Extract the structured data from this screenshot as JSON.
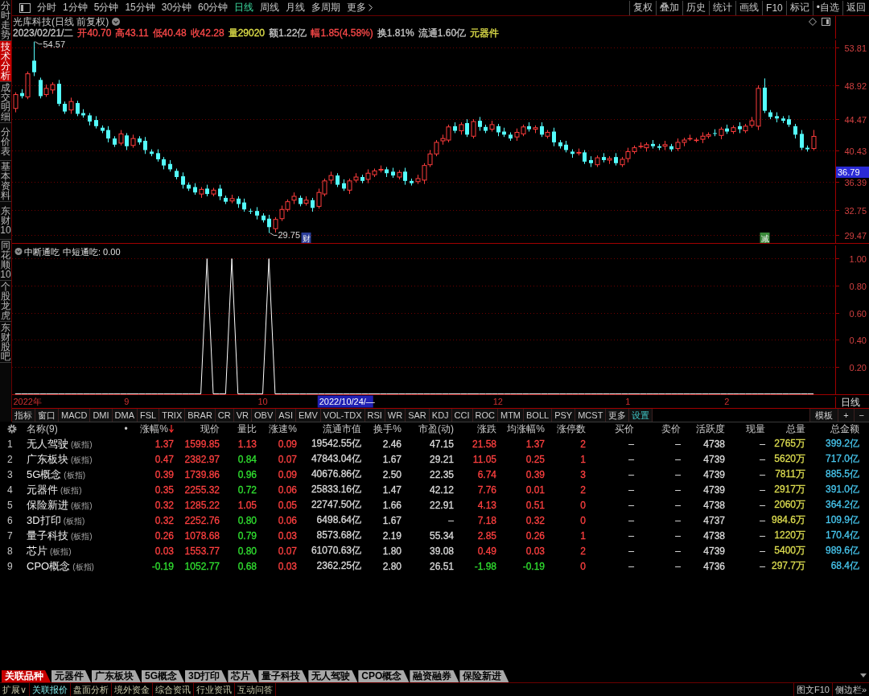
{
  "toolbar": {
    "periods": [
      {
        "label": "分时",
        "selected": false
      },
      {
        "label": "1分钟",
        "selected": false
      },
      {
        "label": "5分钟",
        "selected": false
      },
      {
        "label": "15分钟",
        "selected": false
      },
      {
        "label": "30分钟",
        "selected": false
      },
      {
        "label": "60分钟",
        "selected": false
      },
      {
        "label": "日线",
        "selected": true
      },
      {
        "label": "周线",
        "selected": false
      },
      {
        "label": "月线",
        "selected": false
      },
      {
        "label": "多周期",
        "selected": false
      }
    ],
    "more": "更多",
    "actions": [
      "复权",
      "叠加",
      "历史",
      "统计",
      "画线",
      "F10",
      "标记",
      "•自选",
      "返回"
    ]
  },
  "sidebar": {
    "tabs": [
      {
        "label": "分时走势",
        "selected": false
      },
      {
        "label": "技术分析",
        "selected": true
      },
      {
        "label": "成交明细",
        "selected": false
      },
      {
        "label": "分价表",
        "selected": false
      },
      {
        "label": "基本资料",
        "selected": false
      },
      {
        "label": "东财10",
        "selected": false
      },
      {
        "label": "同花顺10",
        "selected": false
      },
      {
        "label": "个股龙虎",
        "selected": false
      },
      {
        "label": "东财股吧",
        "selected": false
      }
    ]
  },
  "chart_header": {
    "title": "光库科技(日线 前复权)",
    "date": "2023/02/21/二",
    "quote": [
      {
        "text": "开40.70",
        "color": "#ff4a4a"
      },
      {
        "text": "高43.11",
        "color": "#ff4a4a"
      },
      {
        "text": "低40.48",
        "color": "#ff4a4a"
      },
      {
        "text": "收42.28",
        "color": "#ff4a4a"
      },
      {
        "text": "量29020",
        "color": "#e0e04a"
      },
      {
        "text": "额1.22亿",
        "color": "#c8c8c8"
      },
      {
        "text": "幅1.85(4.58%)",
        "color": "#ff4a4a"
      },
      {
        "text": "换1.81%",
        "color": "#c8c8c8"
      },
      {
        "text": "流通1.60亿",
        "color": "#c8c8c8"
      },
      {
        "text": "元器件",
        "color": "#e0e04a"
      }
    ]
  },
  "price_chart": {
    "chart_data": {
      "type": "candlestick",
      "grid": true,
      "ylim": [
        28.39,
        54.96
      ],
      "yticks": [
        {
          "value": 53.81,
          "label": "53.81"
        },
        {
          "value": 48.92,
          "label": "48.92"
        },
        {
          "value": 44.47,
          "label": "44.47"
        },
        {
          "value": 40.43,
          "label": "40.43"
        },
        {
          "value": 36.39,
          "label": "36.39"
        },
        {
          "value": 32.75,
          "label": "32.75"
        },
        {
          "value": 29.47,
          "label": "29.47"
        }
      ],
      "categories": [
        null,
        null,
        null,
        null,
        null,
        null,
        null,
        null,
        null,
        null,
        null,
        null,
        null,
        null,
        null,
        null,
        null,
        null,
        null,
        null,
        null,
        null,
        null,
        null,
        null,
        null,
        null,
        null,
        null,
        null,
        null,
        null,
        null,
        null,
        null,
        null,
        null,
        null,
        null,
        null,
        null,
        null,
        null,
        null,
        null,
        null,
        null,
        null,
        null,
        null,
        null,
        null,
        null,
        null,
        null,
        null,
        null,
        null,
        null,
        null,
        null,
        null,
        null,
        null,
        null,
        null,
        null,
        null,
        null,
        null,
        null,
        null,
        null,
        null,
        null,
        null,
        null,
        null,
        null,
        null,
        null,
        null,
        null,
        null,
        null,
        null,
        null,
        null,
        null,
        null,
        null,
        null,
        null,
        null,
        null,
        null,
        null,
        null,
        null,
        null,
        null,
        null,
        null,
        null,
        null,
        null,
        null,
        null,
        null,
        null,
        null,
        null,
        null,
        null,
        null,
        null,
        null,
        null,
        null,
        null,
        null,
        null,
        null,
        null,
        null,
        null,
        null,
        null,
        null,
        null,
        null,
        null,
        null
      ],
      "ohlc": [
        [
          45.9,
          48.0,
          45.4,
          47.7
        ],
        [
          47.9,
          48.4,
          47.2,
          47.5
        ],
        [
          47.4,
          50.7,
          47.1,
          50.4
        ],
        [
          52.1,
          54.57,
          50.1,
          50.6
        ],
        [
          49.6,
          49.9,
          47.2,
          47.5
        ],
        [
          47.7,
          49.0,
          47.4,
          48.5
        ],
        [
          48.3,
          49.3,
          47.8,
          49.0
        ],
        [
          49.1,
          49.6,
          46.2,
          46.5
        ],
        [
          46.5,
          46.8,
          45.2,
          45.5
        ],
        [
          45.7,
          47.3,
          45.2,
          46.8
        ],
        [
          46.6,
          46.9,
          44.9,
          45.2
        ],
        [
          45.3,
          45.8,
          44.7,
          45.0
        ],
        [
          45.0,
          45.3,
          43.7,
          44.2
        ],
        [
          44.4,
          44.9,
          43.3,
          43.6
        ],
        [
          43.4,
          43.7,
          42.7,
          43.0
        ],
        [
          43.1,
          43.6,
          41.5,
          42.0
        ],
        [
          42.0,
          42.3,
          40.9,
          41.2
        ],
        [
          41.4,
          43.1,
          41.1,
          42.6
        ],
        [
          42.4,
          42.7,
          40.5,
          41.0
        ],
        [
          41.1,
          42.5,
          40.8,
          42.0
        ],
        [
          42.0,
          42.3,
          41.2,
          41.5
        ],
        [
          41.7,
          42.2,
          40.0,
          40.5
        ],
        [
          40.3,
          40.6,
          39.7,
          40.0
        ],
        [
          40.1,
          40.6,
          39.0,
          39.3
        ],
        [
          39.3,
          39.6,
          38.0,
          38.5
        ],
        [
          38.7,
          39.2,
          37.7,
          38.0
        ],
        [
          37.8,
          38.1,
          36.7,
          37.0
        ],
        [
          37.1,
          37.6,
          35.5,
          36.0
        ],
        [
          36.0,
          36.3,
          35.2,
          35.5
        ],
        [
          35.7,
          36.2,
          34.7,
          35.0
        ],
        [
          34.8,
          35.7,
          34.3,
          35.4
        ],
        [
          35.5,
          36.0,
          34.5,
          34.8
        ],
        [
          34.8,
          35.6,
          34.5,
          35.3
        ],
        [
          35.5,
          36.0,
          34.0,
          34.5
        ],
        [
          34.3,
          34.6,
          33.5,
          33.8
        ],
        [
          33.9,
          34.7,
          33.6,
          34.2
        ],
        [
          34.2,
          34.5,
          33.0,
          33.5
        ],
        [
          33.7,
          34.2,
          32.5,
          32.8
        ],
        [
          32.6,
          32.9,
          32.2,
          32.5
        ],
        [
          32.6,
          33.1,
          31.5,
          32.0
        ],
        [
          32.0,
          32.3,
          31.1,
          31.4
        ],
        [
          31.6,
          32.1,
          29.75,
          30.5
        ],
        [
          30.3,
          31.8,
          29.8,
          31.5
        ],
        [
          31.6,
          33.3,
          31.3,
          32.8
        ],
        [
          32.8,
          34.1,
          32.5,
          33.8
        ],
        [
          34.0,
          35.0,
          33.5,
          34.5
        ],
        [
          34.3,
          34.6,
          33.2,
          33.5
        ],
        [
          33.6,
          34.5,
          33.3,
          34.0
        ],
        [
          34.0,
          34.3,
          32.5,
          33.0
        ],
        [
          33.2,
          35.5,
          32.9,
          35.0
        ],
        [
          34.8,
          36.8,
          34.5,
          36.5
        ],
        [
          36.6,
          37.7,
          36.1,
          37.2
        ],
        [
          37.2,
          37.5,
          35.7,
          36.0
        ],
        [
          36.2,
          36.7,
          35.2,
          35.5
        ],
        [
          35.3,
          36.8,
          34.8,
          36.5
        ],
        [
          36.6,
          37.5,
          36.3,
          37.0
        ],
        [
          37.0,
          37.3,
          36.2,
          36.5
        ],
        [
          36.7,
          38.0,
          36.2,
          37.5
        ],
        [
          37.3,
          38.1,
          37.0,
          37.8
        ],
        [
          37.9,
          38.5,
          37.6,
          38.0
        ],
        [
          38.0,
          38.3,
          37.0,
          37.5
        ],
        [
          37.7,
          38.2,
          36.9,
          37.2
        ],
        [
          37.0,
          37.9,
          36.7,
          37.6
        ],
        [
          37.7,
          38.2,
          36.0,
          36.5
        ],
        [
          36.5,
          36.8,
          35.9,
          36.2
        ],
        [
          36.4,
          37.3,
          36.1,
          36.8
        ],
        [
          36.6,
          38.8,
          36.1,
          38.5
        ],
        [
          38.6,
          40.5,
          38.3,
          40.0
        ],
        [
          40.0,
          41.8,
          39.7,
          41.5
        ],
        [
          41.7,
          42.5,
          41.2,
          42.0
        ],
        [
          41.8,
          43.8,
          41.5,
          43.5
        ],
        [
          43.6,
          44.1,
          42.7,
          43.0
        ],
        [
          43.0,
          44.1,
          42.5,
          43.8
        ],
        [
          44.0,
          44.5,
          42.2,
          42.5
        ],
        [
          42.3,
          44.5,
          42.0,
          44.2
        ],
        [
          44.3,
          44.8,
          43.0,
          43.5
        ],
        [
          43.5,
          43.8,
          42.7,
          43.0
        ],
        [
          43.2,
          44.3,
          42.9,
          43.8
        ],
        [
          43.6,
          43.9,
          42.3,
          42.8
        ],
        [
          42.9,
          43.4,
          42.2,
          42.5
        ],
        [
          42.5,
          42.8,
          41.7,
          42.0
        ],
        [
          42.2,
          43.3,
          41.7,
          42.8
        ],
        [
          42.6,
          43.8,
          42.3,
          43.5
        ],
        [
          43.6,
          44.1,
          42.9,
          43.2
        ],
        [
          43.2,
          43.7,
          42.7,
          43.4
        ],
        [
          43.6,
          44.1,
          42.2,
          42.5
        ],
        [
          42.3,
          43.1,
          42.0,
          42.8
        ],
        [
          42.9,
          43.4,
          41.0,
          41.5
        ],
        [
          41.5,
          41.8,
          40.7,
          41.0
        ],
        [
          41.2,
          41.7,
          40.2,
          40.5
        ],
        [
          40.3,
          40.6,
          39.5,
          40.0
        ],
        [
          40.1,
          40.7,
          39.8,
          40.2
        ],
        [
          40.2,
          40.5,
          38.7,
          39.0
        ],
        [
          39.2,
          39.7,
          38.3,
          38.8
        ],
        [
          38.6,
          39.8,
          38.3,
          39.5
        ],
        [
          39.6,
          40.1,
          38.9,
          39.2
        ],
        [
          39.2,
          39.7,
          38.7,
          39.4
        ],
        [
          39.6,
          40.1,
          38.5,
          38.8
        ],
        [
          38.6,
          39.6,
          38.3,
          39.3
        ],
        [
          39.4,
          40.8,
          38.9,
          40.3
        ],
        [
          40.3,
          41.1,
          40.0,
          40.8
        ],
        [
          41.0,
          41.5,
          40.7,
          41.0
        ],
        [
          40.8,
          41.5,
          40.3,
          41.2
        ],
        [
          41.3,
          41.8,
          40.7,
          41.0
        ],
        [
          41.0,
          41.3,
          40.5,
          40.8
        ],
        [
          41.0,
          41.7,
          40.5,
          41.2
        ],
        [
          41.0,
          41.3,
          40.3,
          40.6
        ],
        [
          40.7,
          42.0,
          40.4,
          41.5
        ],
        [
          41.5,
          42.1,
          41.0,
          41.8
        ],
        [
          42.0,
          42.5,
          41.7,
          42.0
        ],
        [
          41.8,
          42.1,
          41.5,
          41.8
        ],
        [
          41.9,
          42.8,
          41.4,
          42.3
        ],
        [
          42.3,
          42.8,
          42.0,
          42.5
        ],
        [
          42.7,
          43.2,
          42.3,
          42.6
        ],
        [
          42.4,
          43.5,
          41.9,
          43.2
        ],
        [
          43.3,
          43.8,
          42.6,
          42.9
        ],
        [
          42.9,
          43.7,
          42.6,
          43.4
        ],
        [
          43.6,
          44.1,
          42.7,
          43.2
        ],
        [
          43.0,
          43.9,
          42.7,
          43.6
        ],
        [
          43.7,
          44.8,
          43.4,
          44.3
        ],
        [
          43.6,
          48.9,
          43.1,
          48.5
        ],
        [
          48.6,
          49.8,
          45.3,
          45.6
        ],
        [
          45.4,
          45.7,
          44.5,
          44.8
        ],
        [
          44.9,
          45.4,
          44.1,
          44.6
        ],
        [
          44.6,
          44.9,
          44.0,
          44.3
        ],
        [
          44.5,
          45.0,
          43.5,
          43.8
        ],
        [
          43.6,
          43.9,
          42.0,
          42.5
        ],
        [
          42.6,
          43.1,
          40.5,
          40.8
        ],
        [
          40.8,
          41.1,
          40.3,
          40.6
        ],
        [
          40.7,
          43.11,
          40.48,
          42.28
        ],
        null,
        null,
        null
      ]
    },
    "high_label": "54.57",
    "low_label": "29.75",
    "cursor_price": "36.79",
    "events": [
      {
        "text": "财",
        "kind": "report"
      },
      {
        "text": "减",
        "kind": "reduce"
      }
    ]
  },
  "indicator": {
    "reading": "中短通吃: 0.00",
    "date_cursor": "2022/10/24/—",
    "chart_data": {
      "type": "line",
      "title": "中断通吃",
      "grid": true,
      "ylim": [
        0,
        1.11
      ],
      "categories": [
        null,
        null,
        "2022年",
        null,
        null,
        null,
        null,
        null,
        null,
        null,
        null,
        null,
        null,
        null,
        null,
        null,
        null,
        null,
        "9",
        null,
        null,
        null,
        null,
        null,
        null,
        null,
        null,
        null,
        null,
        null,
        null,
        null,
        null,
        null,
        null,
        null,
        null,
        null,
        null,
        null,
        "10",
        null,
        null,
        null,
        null,
        null,
        null,
        null,
        null,
        null,
        null,
        null,
        null,
        null,
        null,
        null,
        null,
        null,
        null,
        null,
        null,
        null,
        null,
        null,
        null,
        null,
        null,
        null,
        null,
        null,
        null,
        null,
        null,
        null,
        null,
        null,
        null,
        null,
        "12",
        null,
        null,
        null,
        null,
        null,
        null,
        null,
        null,
        null,
        null,
        null,
        null,
        null,
        null,
        null,
        null,
        null,
        null,
        null,
        null,
        "1",
        null,
        null,
        null,
        null,
        null,
        null,
        null,
        null,
        null,
        null,
        null,
        null,
        null,
        null,
        null,
        "2",
        null,
        null,
        null,
        null,
        null,
        null,
        null,
        null,
        null,
        null,
        null,
        null,
        null,
        null,
        null,
        null,
        null
      ],
      "series": [
        {
          "color": "#ffffff",
          "values": [
            0,
            0,
            0,
            0,
            0,
            0,
            0,
            0,
            0,
            0,
            0,
            0,
            0,
            0,
            0,
            0,
            0,
            0,
            0,
            0,
            0,
            0,
            0,
            0,
            0,
            0,
            0,
            0,
            0,
            0,
            0,
            1,
            0,
            0,
            0,
            1,
            0,
            0,
            0,
            0,
            0,
            1,
            0,
            0,
            0,
            0,
            0,
            0,
            0,
            0,
            0,
            0,
            0,
            0,
            0,
            0,
            0,
            0,
            0,
            0,
            0,
            0,
            0,
            0,
            0,
            0,
            0,
            0,
            0,
            0,
            0,
            0,
            0,
            0,
            0,
            0,
            0,
            0,
            0,
            0,
            0,
            0,
            0,
            0,
            0,
            0,
            0,
            0,
            0,
            0,
            0,
            0,
            0,
            0,
            0,
            0,
            0,
            0,
            0,
            0,
            0,
            0,
            0,
            0,
            0,
            0,
            0,
            0,
            0,
            0,
            0,
            0,
            0,
            0,
            0,
            0,
            0,
            0,
            0,
            0,
            0,
            0,
            0,
            0,
            0,
            0,
            0,
            0,
            0,
            0,
            null,
            null,
            null
          ]
        }
      ],
      "yticks": [
        {
          "value": 1,
          "label": "1.00"
        },
        {
          "value": 0.8,
          "label": "0.80"
        },
        {
          "value": 0.6,
          "label": "0.60"
        },
        {
          "value": 0.4,
          "label": "0.40"
        },
        {
          "value": 0.2,
          "label": "0.20"
        }
      ]
    }
  },
  "period_label": "日线",
  "indicator_tabs": {
    "items": [
      "指标",
      "窗口",
      "MACD",
      "DMI",
      "DMA",
      "FSL",
      "TRIX",
      "BRAR",
      "CR",
      "VR",
      "OBV",
      "ASI",
      "EMV",
      "VOL-TDX",
      "RSI",
      "WR",
      "SAR",
      "KDJ",
      "CCI",
      "ROC",
      "MTM",
      "BOLL",
      "PSY",
      "MCST",
      "更多"
    ],
    "settings": "设置",
    "tools": [
      "模板",
      "+",
      "−"
    ]
  },
  "table": {
    "columns": [
      {
        "label": "名称(9)",
        "sorted": false
      },
      {
        "label": "•",
        "sorted": false
      },
      {
        "label": "涨幅%",
        "sorted": true
      },
      {
        "label": "现价",
        "sorted": false
      },
      {
        "label": "量比",
        "sorted": false
      },
      {
        "label": "涨速%",
        "sorted": false
      },
      {
        "label": "流通市值",
        "sorted": false
      },
      {
        "label": "换手%",
        "sorted": false
      },
      {
        "label": "市盈(动)",
        "sorted": false
      },
      {
        "label": "涨跌",
        "sorted": false
      },
      {
        "label": "均涨幅%",
        "sorted": false
      },
      {
        "label": "涨停数",
        "sorted": false
      },
      {
        "label": "买价",
        "sorted": false
      },
      {
        "label": "卖价",
        "sorted": false
      },
      {
        "label": "活跃度",
        "sorted": false
      },
      {
        "label": "现量",
        "sorted": false
      },
      {
        "label": "总量",
        "sorted": false
      },
      {
        "label": "总金额",
        "sorted": false
      }
    ],
    "rows": [
      {
        "index": "1",
        "cells": [
          {
            "text": "无人驾驶",
            "tag": "(板指)"
          },
          {
            "text": ""
          },
          {
            "text": "1.37",
            "color": "#ff4040"
          },
          {
            "text": "1599.85",
            "color": "#ff4040"
          },
          {
            "text": "1.13",
            "color": "#ff4040"
          },
          {
            "text": "0.09",
            "color": "#ff4040"
          },
          {
            "text": "19542.55亿",
            "color": "#dcdcdc"
          },
          {
            "text": "2.46",
            "color": "#dcdcdc"
          },
          {
            "text": "47.15",
            "color": "#dcdcdc"
          },
          {
            "text": "21.58",
            "color": "#ff4040"
          },
          {
            "text": "1.37",
            "color": "#ff4040"
          },
          {
            "text": "2",
            "color": "#ff4040"
          },
          {
            "text": "–"
          },
          {
            "text": "–"
          },
          {
            "text": "4738",
            "color": "#dcdcdc"
          },
          {
            "text": "–"
          },
          {
            "text": "2765万",
            "color": "#dede50"
          },
          {
            "text": "399.2亿",
            "color": "#48c8f0"
          }
        ]
      },
      {
        "index": "2",
        "cells": [
          {
            "text": "广东板块",
            "tag": "(板指)"
          },
          {
            "text": ""
          },
          {
            "text": "0.47",
            "color": "#ff4040"
          },
          {
            "text": "2382.97",
            "color": "#ff4040"
          },
          {
            "text": "0.84",
            "color": "#30e030"
          },
          {
            "text": "0.07",
            "color": "#ff4040"
          },
          {
            "text": "47843.04亿",
            "color": "#dcdcdc"
          },
          {
            "text": "1.67",
            "color": "#dcdcdc"
          },
          {
            "text": "29.21",
            "color": "#dcdcdc"
          },
          {
            "text": "11.05",
            "color": "#ff4040"
          },
          {
            "text": "0.25",
            "color": "#ff4040"
          },
          {
            "text": "1",
            "color": "#ff4040"
          },
          {
            "text": "–"
          },
          {
            "text": "–"
          },
          {
            "text": "4739",
            "color": "#dcdcdc"
          },
          {
            "text": "–"
          },
          {
            "text": "5620万",
            "color": "#dede50"
          },
          {
            "text": "717.0亿",
            "color": "#48c8f0"
          }
        ]
      },
      {
        "index": "3",
        "cells": [
          {
            "text": "5G概念",
            "tag": "(板指)"
          },
          {
            "text": ""
          },
          {
            "text": "0.39",
            "color": "#ff4040"
          },
          {
            "text": "1739.86",
            "color": "#ff4040"
          },
          {
            "text": "0.96",
            "color": "#30e030"
          },
          {
            "text": "0.09",
            "color": "#ff4040"
          },
          {
            "text": "40676.86亿",
            "color": "#dcdcdc"
          },
          {
            "text": "2.50",
            "color": "#dcdcdc"
          },
          {
            "text": "22.35",
            "color": "#dcdcdc"
          },
          {
            "text": "6.74",
            "color": "#ff4040"
          },
          {
            "text": "0.39",
            "color": "#ff4040"
          },
          {
            "text": "3",
            "color": "#ff4040"
          },
          {
            "text": "–"
          },
          {
            "text": "–"
          },
          {
            "text": "4739",
            "color": "#dcdcdc"
          },
          {
            "text": "–"
          },
          {
            "text": "7811万",
            "color": "#dede50"
          },
          {
            "text": "885.5亿",
            "color": "#48c8f0"
          }
        ]
      },
      {
        "index": "4",
        "cells": [
          {
            "text": "元器件",
            "tag": "(板指)"
          },
          {
            "text": ""
          },
          {
            "text": "0.35",
            "color": "#ff4040"
          },
          {
            "text": "2255.32",
            "color": "#ff4040"
          },
          {
            "text": "0.72",
            "color": "#30e030"
          },
          {
            "text": "0.06",
            "color": "#ff4040"
          },
          {
            "text": "25833.16亿",
            "color": "#dcdcdc"
          },
          {
            "text": "1.47",
            "color": "#dcdcdc"
          },
          {
            "text": "42.12",
            "color": "#dcdcdc"
          },
          {
            "text": "7.76",
            "color": "#ff4040"
          },
          {
            "text": "0.01",
            "color": "#ff4040"
          },
          {
            "text": "2",
            "color": "#ff4040"
          },
          {
            "text": "–"
          },
          {
            "text": "–"
          },
          {
            "text": "4739",
            "color": "#dcdcdc"
          },
          {
            "text": "–"
          },
          {
            "text": "2917万",
            "color": "#dede50"
          },
          {
            "text": "391.0亿",
            "color": "#48c8f0"
          }
        ]
      },
      {
        "index": "5",
        "cells": [
          {
            "text": "保险新进",
            "tag": "(板指)"
          },
          {
            "text": ""
          },
          {
            "text": "0.32",
            "color": "#ff4040"
          },
          {
            "text": "1285.22",
            "color": "#ff4040"
          },
          {
            "text": "1.05",
            "color": "#ff4040"
          },
          {
            "text": "0.05",
            "color": "#ff4040"
          },
          {
            "text": "22747.50亿",
            "color": "#dcdcdc"
          },
          {
            "text": "1.66",
            "color": "#dcdcdc"
          },
          {
            "text": "22.91",
            "color": "#dcdcdc"
          },
          {
            "text": "4.13",
            "color": "#ff4040"
          },
          {
            "text": "0.51",
            "color": "#ff4040"
          },
          {
            "text": "0",
            "color": "#ff4040"
          },
          {
            "text": "–"
          },
          {
            "text": "–"
          },
          {
            "text": "4738",
            "color": "#dcdcdc"
          },
          {
            "text": "–"
          },
          {
            "text": "2060万",
            "color": "#dede50"
          },
          {
            "text": "364.2亿",
            "color": "#48c8f0"
          }
        ]
      },
      {
        "index": "6",
        "cells": [
          {
            "text": "3D打印",
            "tag": "(板指)"
          },
          {
            "text": ""
          },
          {
            "text": "0.32",
            "color": "#ff4040"
          },
          {
            "text": "2252.76",
            "color": "#ff4040"
          },
          {
            "text": "0.80",
            "color": "#30e030"
          },
          {
            "text": "0.06",
            "color": "#ff4040"
          },
          {
            "text": "6498.64亿",
            "color": "#dcdcdc"
          },
          {
            "text": "1.67",
            "color": "#dcdcdc"
          },
          {
            "text": "–"
          },
          {
            "text": "7.18",
            "color": "#ff4040"
          },
          {
            "text": "0.32",
            "color": "#ff4040"
          },
          {
            "text": "0",
            "color": "#ff4040"
          },
          {
            "text": "–"
          },
          {
            "text": "–"
          },
          {
            "text": "4737",
            "color": "#dcdcdc"
          },
          {
            "text": "–"
          },
          {
            "text": "984.6万",
            "color": "#dede50"
          },
          {
            "text": "109.9亿",
            "color": "#48c8f0"
          }
        ]
      },
      {
        "index": "7",
        "cells": [
          {
            "text": "量子科技",
            "tag": "(板指)"
          },
          {
            "text": ""
          },
          {
            "text": "0.26",
            "color": "#ff4040"
          },
          {
            "text": "1078.68",
            "color": "#ff4040"
          },
          {
            "text": "0.79",
            "color": "#30e030"
          },
          {
            "text": "0.03",
            "color": "#ff4040"
          },
          {
            "text": "8573.68亿",
            "color": "#dcdcdc"
          },
          {
            "text": "2.19",
            "color": "#dcdcdc"
          },
          {
            "text": "55.34",
            "color": "#dcdcdc"
          },
          {
            "text": "2.85",
            "color": "#ff4040"
          },
          {
            "text": "0.26",
            "color": "#ff4040"
          },
          {
            "text": "1",
            "color": "#ff4040"
          },
          {
            "text": "–"
          },
          {
            "text": "–"
          },
          {
            "text": "4738",
            "color": "#dcdcdc"
          },
          {
            "text": "–"
          },
          {
            "text": "1220万",
            "color": "#dede50"
          },
          {
            "text": "170.4亿",
            "color": "#48c8f0"
          }
        ]
      },
      {
        "index": "8",
        "cells": [
          {
            "text": "芯片",
            "tag": "(板指)"
          },
          {
            "text": ""
          },
          {
            "text": "0.03",
            "color": "#ff4040"
          },
          {
            "text": "1553.77",
            "color": "#ff4040"
          },
          {
            "text": "0.80",
            "color": "#30e030"
          },
          {
            "text": "0.07",
            "color": "#ff4040"
          },
          {
            "text": "61070.63亿",
            "color": "#dcdcdc"
          },
          {
            "text": "1.80",
            "color": "#dcdcdc"
          },
          {
            "text": "39.08",
            "color": "#dcdcdc"
          },
          {
            "text": "0.49",
            "color": "#ff4040"
          },
          {
            "text": "0.03",
            "color": "#ff4040"
          },
          {
            "text": "2",
            "color": "#ff4040"
          },
          {
            "text": "–"
          },
          {
            "text": "–"
          },
          {
            "text": "4739",
            "color": "#dcdcdc"
          },
          {
            "text": "–"
          },
          {
            "text": "5400万",
            "color": "#dede50"
          },
          {
            "text": "989.6亿",
            "color": "#48c8f0"
          }
        ]
      },
      {
        "index": "9",
        "cells": [
          {
            "text": "CPO概念",
            "tag": "(板指)"
          },
          {
            "text": ""
          },
          {
            "text": "-0.19",
            "color": "#30e030"
          },
          {
            "text": "1052.77",
            "color": "#30e030"
          },
          {
            "text": "0.68",
            "color": "#30e030"
          },
          {
            "text": "0.03",
            "color": "#ff4040"
          },
          {
            "text": "2362.25亿",
            "color": "#dcdcdc"
          },
          {
            "text": "2.80",
            "color": "#dcdcdc"
          },
          {
            "text": "26.51",
            "color": "#dcdcdc"
          },
          {
            "text": "-1.98",
            "color": "#30e030"
          },
          {
            "text": "-0.19",
            "color": "#30e030"
          },
          {
            "text": "0",
            "color": "#ff4040"
          },
          {
            "text": "–"
          },
          {
            "text": "–"
          },
          {
            "text": "4736",
            "color": "#dcdcdc"
          },
          {
            "text": "–"
          },
          {
            "text": "297.7万",
            "color": "#dede50"
          },
          {
            "text": "68.4亿",
            "color": "#48c8f0"
          }
        ]
      }
    ]
  },
  "bottom_tabs": [
    {
      "label": "关联品种",
      "selected": true
    },
    {
      "label": "元器件",
      "selected": false
    },
    {
      "label": "广东板块",
      "selected": false
    },
    {
      "label": "5G概念",
      "selected": false
    },
    {
      "label": "3D打印",
      "selected": false
    },
    {
      "label": "芯片",
      "selected": false
    },
    {
      "label": "量子科技",
      "selected": false
    },
    {
      "label": "无人驾驶",
      "selected": false
    },
    {
      "label": "CPO概念",
      "selected": false
    },
    {
      "label": "融资融券",
      "selected": false
    },
    {
      "label": "保险新进",
      "selected": false
    }
  ],
  "status_bar": {
    "items": [
      {
        "label": "扩展∨",
        "selected": false
      },
      {
        "label": "关联报价",
        "selected": true
      },
      {
        "label": "盘面分析",
        "selected": false
      },
      {
        "label": "境外资金",
        "selected": false
      },
      {
        "label": "综合资讯",
        "selected": false
      },
      {
        "label": "行业资讯",
        "selected": false
      },
      {
        "label": "互动问答",
        "selected": false
      }
    ],
    "right": [
      "图文F10",
      "侧边栏»"
    ]
  }
}
